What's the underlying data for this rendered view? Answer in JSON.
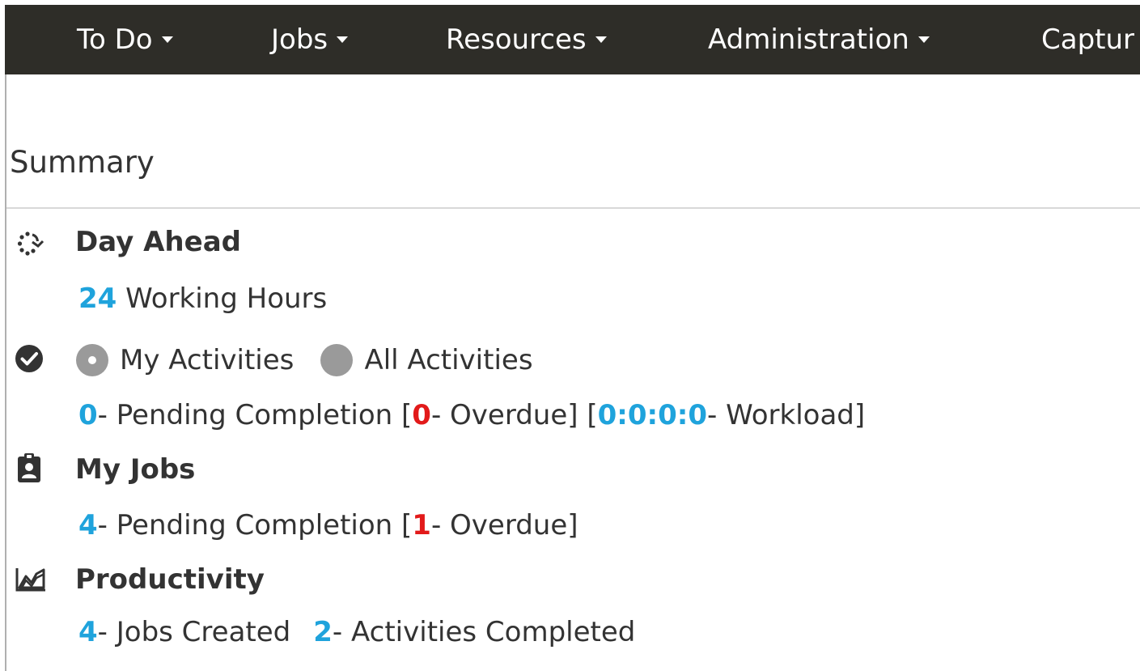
{
  "nav": {
    "todo": "To Do",
    "jobs": "Jobs",
    "resources": "Resources",
    "administration": "Administration",
    "capture": "Captur"
  },
  "summary": {
    "title": "Summary"
  },
  "day_ahead": {
    "title": "Day Ahead",
    "hours_value": "24",
    "hours_label": "Working Hours"
  },
  "activities": {
    "my_label": "My Activities",
    "all_label": "All Activities",
    "selected": "My Activities",
    "pending_value": "0",
    "pending_label": "- Pending Completion [",
    "overdue_value": "0",
    "overdue_label": "- Overdue] [",
    "workload_value": "0:0:0:0",
    "workload_label": "- Workload]"
  },
  "my_jobs": {
    "title": "My Jobs",
    "pending_value": "4",
    "pending_label": "- Pending Completion [",
    "overdue_value": "1",
    "overdue_label": "- Overdue]"
  },
  "productivity": {
    "title": "Productivity",
    "jobs_created_value": "4",
    "jobs_created_label": "- Jobs Created",
    "activities_completed_value": "2",
    "activities_completed_label": "- Activities Completed"
  },
  "colors": {
    "navbar": "#2e2d28",
    "accent_blue": "#1fa3dc",
    "alert_red": "#e21a1a",
    "text": "#333333"
  },
  "icons": {
    "day_ahead": "circular-arrow-icon",
    "activities": "check-circle-icon",
    "my_jobs": "clipboard-user-icon",
    "productivity": "line-chart-icon"
  }
}
